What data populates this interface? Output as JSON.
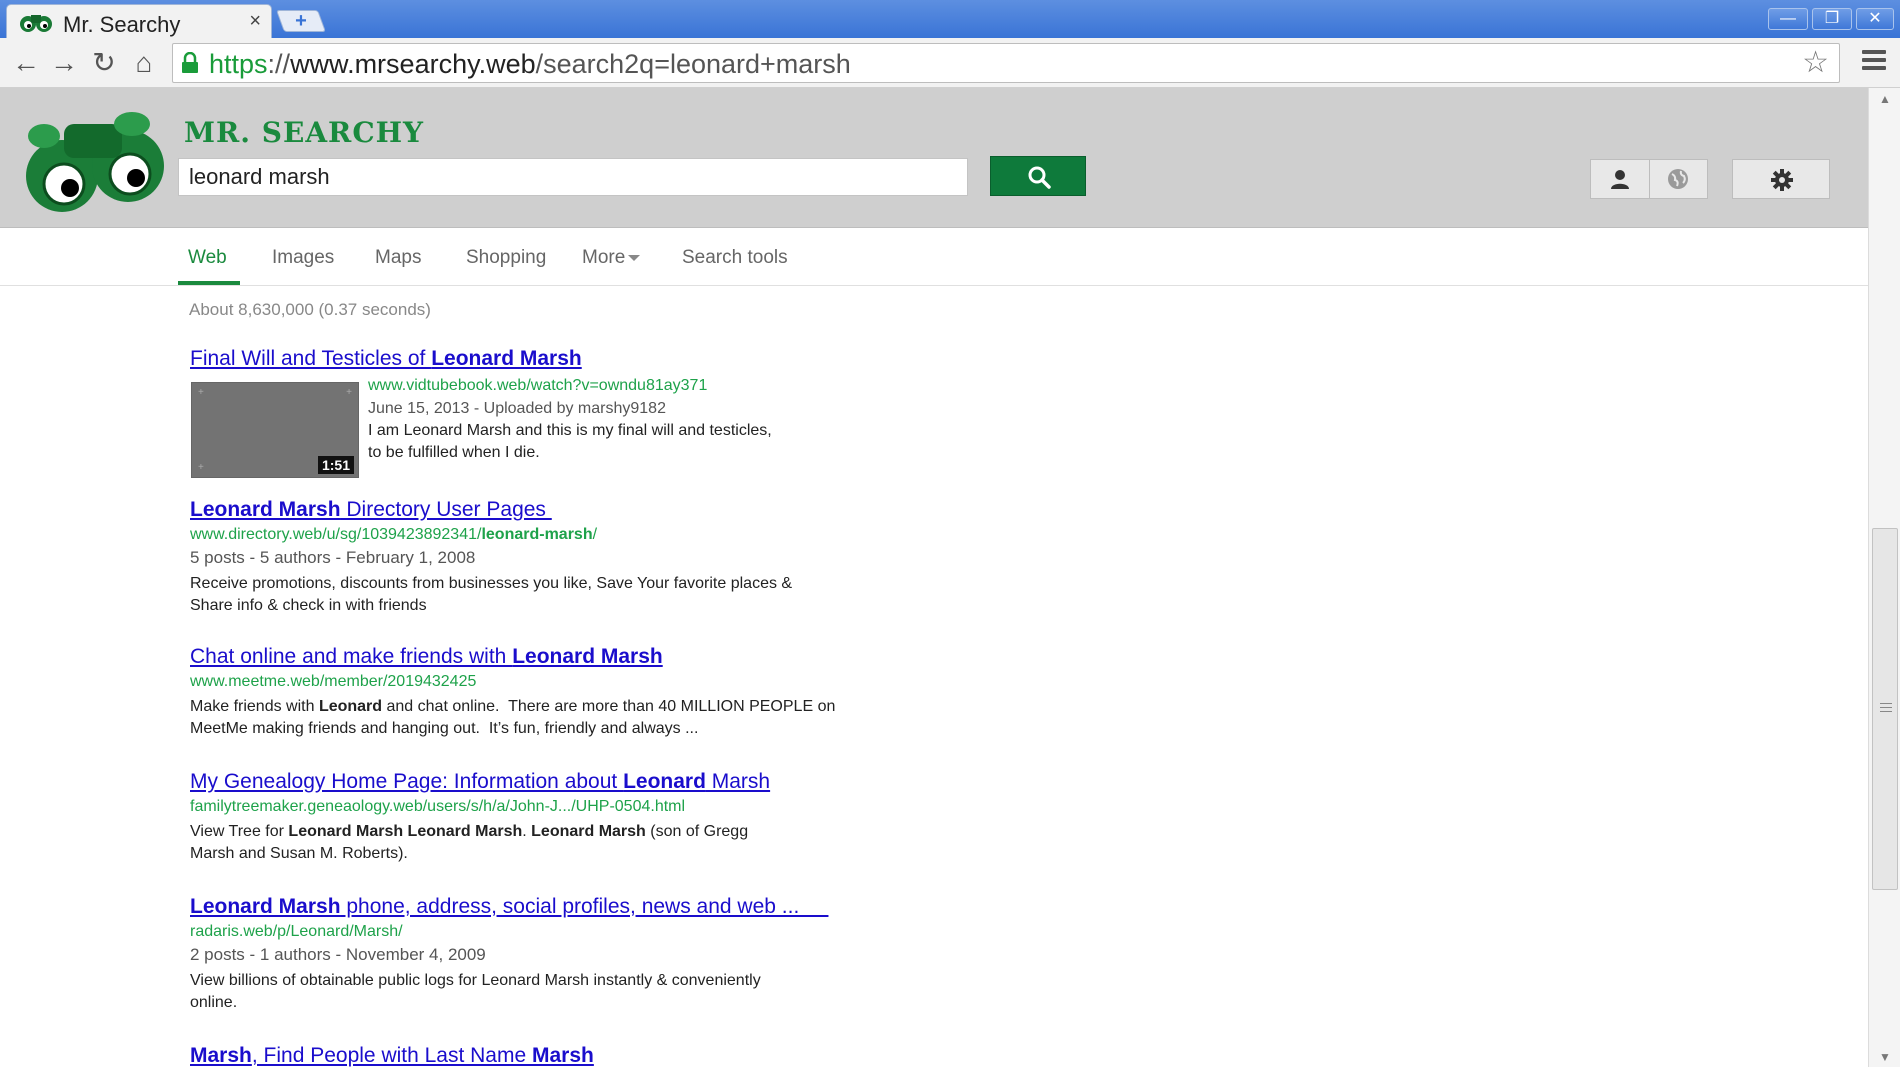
{
  "browser": {
    "tab_title": "Mr. Searchy",
    "tab_close": "×",
    "new_tab": "+",
    "url_scheme": "https",
    "url_sep": "://",
    "url_host": "www.mrsearchy.web",
    "url_path": "/search2q=leonard+marsh",
    "window_buttons": {
      "minimize": "—",
      "restore": "❐",
      "close": "✕"
    },
    "nav": {
      "back": "←",
      "forward": "→",
      "reload": "↻",
      "home": "⌂"
    },
    "star": "☆"
  },
  "header": {
    "brand": "MR. SEARCHY",
    "query": "leonard marsh",
    "accent": "#0e7a3b"
  },
  "tabs": [
    {
      "label": "Web",
      "active": true
    },
    {
      "label": "Images"
    },
    {
      "label": "Maps"
    },
    {
      "label": "Shopping"
    },
    {
      "label": "More"
    },
    {
      "label": "Search tools"
    }
  ],
  "stats": "About 8,630,000 (0.37 seconds)",
  "results": [
    {
      "title_pre": "Final Will and Testicles of ",
      "title_bold": "Leonard Marsh",
      "url": "www.vidtubebook.web/watch?v=owndu81ay371",
      "meta": "June 15, 2013 - Uploaded by marshy9182",
      "snippet_1": "I am Leonard Marsh and this is my final will and testicles,",
      "snippet_2": "to be fulfilled when I die.",
      "duration": "1:51"
    },
    {
      "title_bold": "Leonard Marsh",
      "title_post": " Directory User Pages ",
      "url_pre": "www.directory.web/u/sg/1039423892341/",
      "url_bold": "leonard-marsh",
      "url_post": "/",
      "meta": "5 posts - 5 authors - February 1, 2008",
      "snippet_1": "Receive promotions, discounts from businesses you like, Save Your favorite places &",
      "snippet_2": "Share info & check in with friends"
    },
    {
      "title_pre": "Chat online and make friends with ",
      "title_bold": "Leonard Marsh",
      "url": "www.meetme.web/member/2019432425",
      "snip_a": "Make friends with ",
      "snip_b": "Leonard",
      "snip_c": " and chat online.  There are more than 40 MILLION PEOPLE on",
      "snippet_2": "MeetMe making friends and hanging out.  It’s fun, friendly and always ..."
    },
    {
      "title_pre": "My Genealogy Home Page: Information about ",
      "title_bold": "Leonard",
      "title_post": " Marsh",
      "url": "familytreemaker.geneaology.web/users/s/h/a/John-J.../UHP-0504.html",
      "snip_a": "View Tree for ",
      "snip_b": "Leonard Marsh Leonard Marsh",
      "snip_c": ". ",
      "snip_d": "Leonard Marsh",
      "snip_e": " (son of Gregg",
      "snippet_2": "Marsh and Susan M. Roberts)."
    },
    {
      "title_bold": "Leonard Marsh",
      "title_post": " phone, address, social profiles, news and web ...     ",
      "url": "radaris.web/p/Leonard/Marsh/",
      "meta": "2 posts - 1 authors - November 4, 2009",
      "snippet_1": "View billions of obtainable public logs for Leonard Marsh instantly & conveniently",
      "snippet_2": "online."
    },
    {
      "title_bold": "Marsh",
      "title_mid": ", Find People with Last Name ",
      "title_bold2": "Marsh"
    }
  ]
}
